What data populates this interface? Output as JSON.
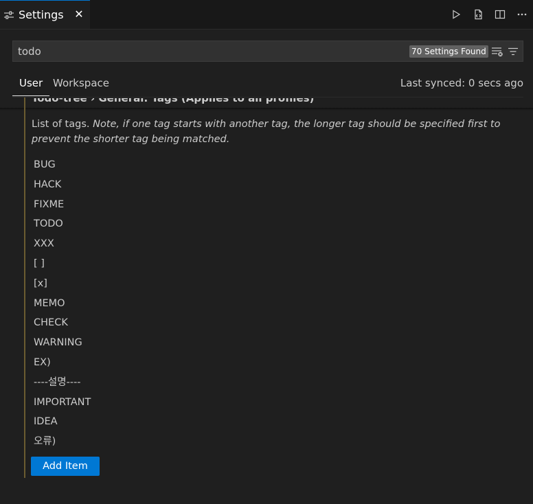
{
  "tab": {
    "title": "Settings",
    "close": "✕"
  },
  "search": {
    "value": "todo",
    "results": "70 Settings Found"
  },
  "scope": {
    "user": "User",
    "workspace": "Workspace",
    "synced": "Last synced: 0 secs ago"
  },
  "setting": {
    "title_cut": "Todo-tree › General: Tags  (Applies to all profiles)",
    "desc_plain": "List of tags. ",
    "desc_italic": "Note, if one tag starts with another tag, the longer tag should be specified first to prevent the shorter tag being matched.",
    "tags": [
      "BUG",
      "HACK",
      "FIXME",
      "TODO",
      "XXX",
      "[ ]",
      "[x]",
      "MEMO",
      "CHECK",
      "WARNING",
      "EX)",
      "----설명----",
      "IMPORTANT",
      "IDEA",
      "오류)"
    ],
    "add_label": "Add Item"
  }
}
